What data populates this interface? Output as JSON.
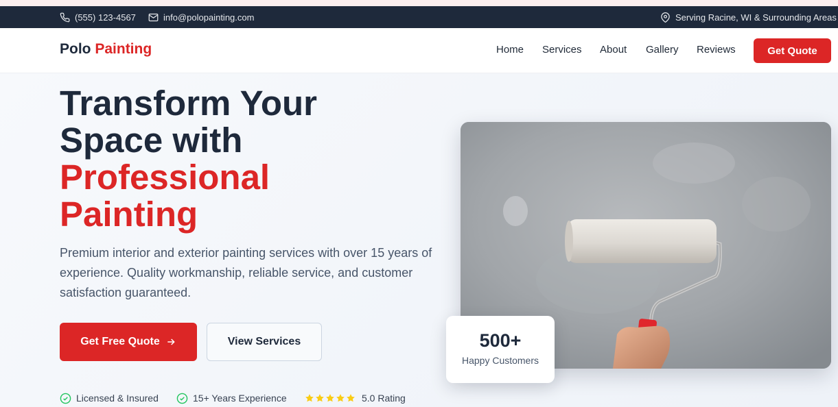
{
  "topbar": {
    "phone": "(555) 123-4567",
    "email": "info@polopainting.com",
    "location": "Serving Racine, WI & Surrounding Areas"
  },
  "nav": {
    "logo_part1": "Polo",
    "logo_part2": "Painting",
    "links": [
      "Home",
      "Services",
      "About",
      "Gallery",
      "Reviews"
    ],
    "cta": "Get Quote"
  },
  "hero": {
    "headline_line1": "Transform Your",
    "headline_line2": "Space with",
    "headline_accent1": "Professional",
    "headline_accent2": "Painting",
    "lead": "Premium interior and exterior painting services with over 15 years of experience. Quality workmanship, reliable service, and customer satisfaction guaranteed.",
    "primary_button": "Get Free Quote",
    "secondary_button": "View Services",
    "trust": {
      "licensed": "Licensed & Insured",
      "experience": "15+ Years Experience",
      "rating": "5.0 Rating",
      "stars": 5
    },
    "stat_number": "500+",
    "stat_label": "Happy Customers"
  },
  "colors": {
    "accent": "#dc2626",
    "dark": "#1e293b",
    "check": "#22c55e",
    "star": "#facc15"
  },
  "icons": {
    "phone": "phone-icon",
    "email": "mail-icon",
    "location": "map-pin-icon",
    "arrow": "arrow-right-icon",
    "check": "check-circle-icon",
    "star": "star-icon"
  }
}
